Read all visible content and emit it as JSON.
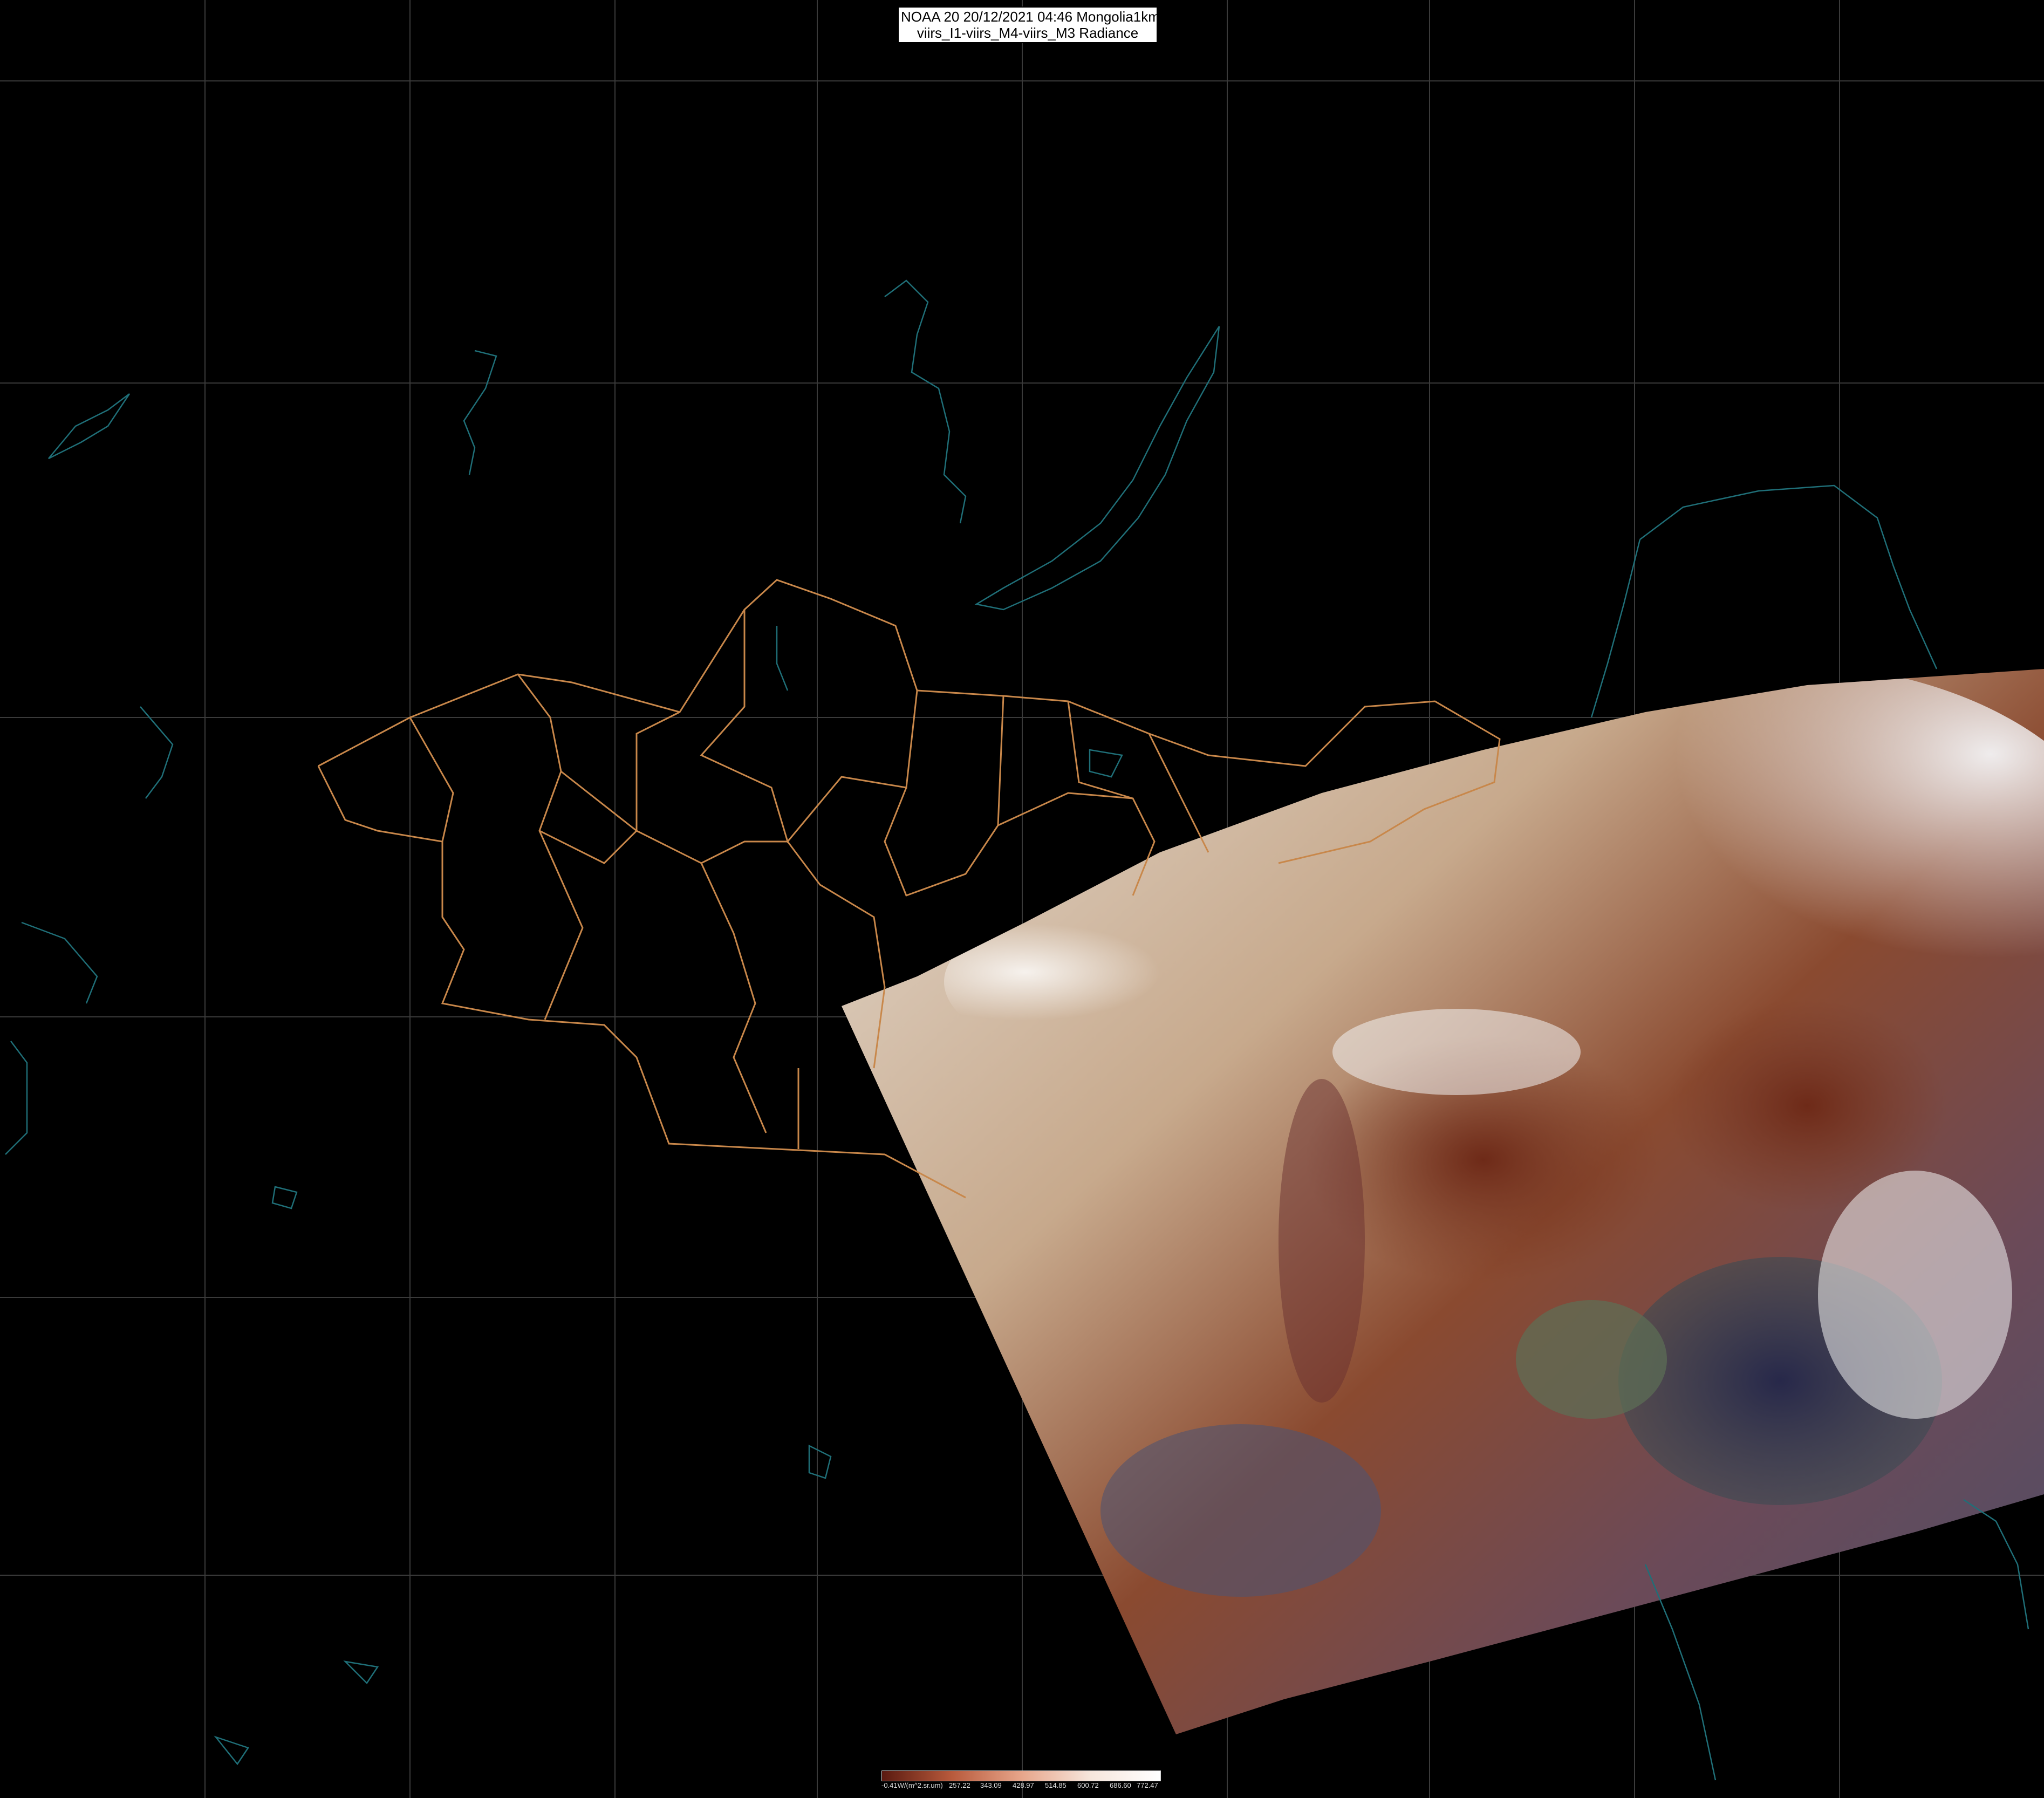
{
  "title": {
    "line1": "NOAA 20 20/12/2021 04:46 Mongolia1km",
    "line2": "viirs_I1-viirs_M4-viirs_M3 Radiance"
  },
  "colorbar": {
    "unit_label": "-0.41W/(m^2.sr.um)",
    "ticks": [
      "257.22",
      "343.09",
      "428.97",
      "514.85",
      "600.72",
      "686.60",
      "772.47"
    ],
    "colors": [
      "#5a1a10",
      "#b85a3c",
      "#e7a58a",
      "#f6e6dc",
      "#ffffff"
    ]
  },
  "map": {
    "background": "#000000",
    "grid_color": "#3a3a3a",
    "border_color": "#c8874a",
    "coast_color": "#1f6f78",
    "grid": true
  }
}
